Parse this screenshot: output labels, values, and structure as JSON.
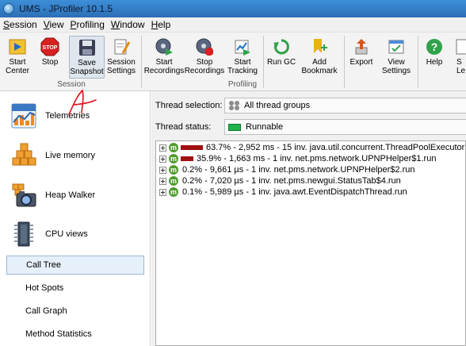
{
  "window": {
    "title": "UMS - JProfiler 10.1.5"
  },
  "menu": [
    {
      "label": "Session",
      "mnemonic": "S",
      "rest": "ession"
    },
    {
      "label": "View",
      "mnemonic": "V",
      "rest": "iew"
    },
    {
      "label": "Profiling",
      "mnemonic": "P",
      "rest": "rofiling"
    },
    {
      "label": "Window",
      "mnemonic": "W",
      "rest": "indow"
    },
    {
      "label": "Help",
      "mnemonic": "H",
      "rest": "elp"
    }
  ],
  "toolbar": {
    "start_center": [
      "Start",
      "Center"
    ],
    "stop": [
      "Stop",
      ""
    ],
    "save_snapshot": [
      "Save",
      "Snapshot"
    ],
    "session_settings": [
      "Session",
      "Settings"
    ],
    "start_recordings": [
      "Start",
      "Recordings"
    ],
    "stop_recordings": [
      "Stop",
      "Recordings"
    ],
    "start_tracking": [
      "Start",
      "Tracking"
    ],
    "run_gc": [
      "Run GC",
      ""
    ],
    "add_bookmark": [
      "Add",
      "Bookmark"
    ],
    "export": [
      "Export",
      ""
    ],
    "view_settings": [
      "View",
      "Settings"
    ],
    "help": [
      "Help",
      ""
    ],
    "start_le": [
      "S",
      "Le"
    ],
    "group_session": "Session",
    "group_profiling": "Profiling"
  },
  "nav": {
    "telemetries": "Telemetries",
    "live_memory": "Live memory",
    "heap_walker": "Heap Walker",
    "cpu_views": "CPU views",
    "sub_items": [
      "Call Tree",
      "Hot Spots",
      "Call Graph",
      "Method Statistics"
    ]
  },
  "filters": {
    "thread_selection_label": "Thread selection:",
    "thread_selection_value": "All thread groups",
    "thread_status_label": "Thread status:",
    "thread_status_value": "Runnable"
  },
  "call_tree": [
    {
      "percent": 63.7,
      "text": "63.7% - 2,952 ms - 15 inv. java.util.concurrent.ThreadPoolExecutor"
    },
    {
      "percent": 35.9,
      "text": "35.9% - 1,663 ms - 1 inv. net.pms.network.UPNPHelper$1.run"
    },
    {
      "percent": 0.2,
      "text": "0.2% - 9,661 µs - 1 inv. net.pms.network.UPNPHelper$2.run"
    },
    {
      "percent": 0.2,
      "text": "0.2% - 7,020 µs - 1 inv. net.pms.newgui.StatusTab$4.run"
    },
    {
      "percent": 0.1,
      "text": "0.1% - 5,989 µs - 1 inv. java.awt.EventDispatchThread.run"
    }
  ],
  "colors": {
    "bar": "#a01010",
    "method_badge": "#4f9c2e",
    "runnable": "#22b14c",
    "selection": "#e6f0fa"
  }
}
